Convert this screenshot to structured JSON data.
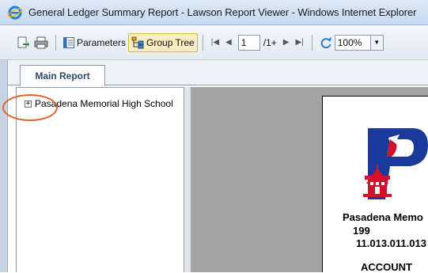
{
  "window": {
    "title": "General Ledger Summary Report - Lawson Report Viewer - Windows Internet Explorer",
    "browser_icon": "internet-explorer-icon"
  },
  "toolbar": {
    "export_icon": "export-icon",
    "print_icon": "print-icon",
    "parameters_label": "Parameters",
    "group_tree_label": "Group Tree",
    "page_value": "1",
    "page_total": "/1+",
    "refresh_icon": "refresh-icon",
    "zoom_value": "100%"
  },
  "tabs": [
    {
      "label": "Main Report"
    }
  ],
  "group_tree": {
    "items": [
      {
        "expander": "+",
        "label": "Pasadena Memorial High School"
      }
    ]
  },
  "report": {
    "org_name": "Pasadena Memo",
    "code": "199",
    "account_number": "11.013.011.013",
    "section_heading": "ACCOUNT"
  },
  "colors": {
    "highlight_ring": "#e0622a",
    "logo_blue": "#1a3a9b",
    "logo_red": "#d2122a"
  }
}
